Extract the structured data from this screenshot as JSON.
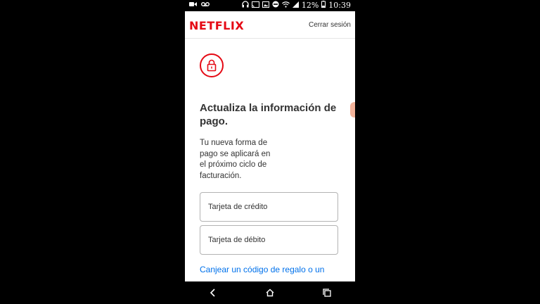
{
  "status_bar": {
    "battery_percent": "12%",
    "time": "10:39",
    "icons": [
      "video-icon",
      "voicemail-icon",
      "headphones-icon",
      "cast-icon",
      "image-icon",
      "do-not-disturb-icon",
      "wifi-icon",
      "signal-icon",
      "battery-icon"
    ]
  },
  "header": {
    "logo": "NETFLIX",
    "sign_out": "Cerrar sesión",
    "brand_color": "#e50914"
  },
  "main": {
    "icon": "lock-icon",
    "title": "Actualiza la información de pago.",
    "description": "Tu nueva forma de pago se aplicará en el próximo ciclo de facturación.",
    "options": [
      {
        "label": "Tarjeta de crédito"
      },
      {
        "label": "Tarjeta de débito"
      }
    ],
    "link": "Canjear un código de regalo o un",
    "link_color": "#0071eb"
  },
  "nav_bar": {
    "icons": [
      "back-icon",
      "home-icon",
      "recents-icon"
    ]
  }
}
